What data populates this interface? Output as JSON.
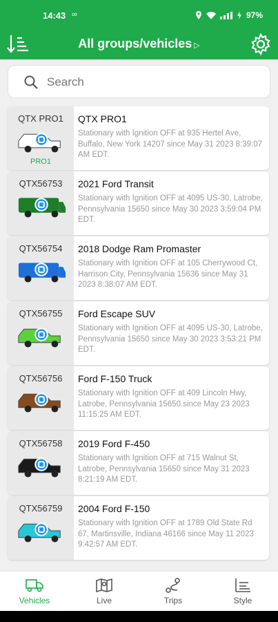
{
  "status": {
    "time": "14:43",
    "left_icon": "∞",
    "battery": "97%"
  },
  "header": {
    "title": "All groups/vehicles",
    "sort_icon": "sort-icon",
    "settings_icon": "gear-icon"
  },
  "search": {
    "placeholder": "Search"
  },
  "colors": {
    "brand": "#1faa4b",
    "vehicle_marker": "#2196f3"
  },
  "vehicles": [
    {
      "code": "QTX PRO1",
      "group": "PRO1",
      "name": "QTX PRO1",
      "desc": "Stationary with Ignition OFF at 935 Hertel Ave, Buffalo, New York 14207 since May 31 2023 8:39:07 AM EDT.",
      "color": "#ffffff"
    },
    {
      "code": "QTX56753",
      "group": "",
      "name": "2021 Ford Transit",
      "desc": "Stationary with Ignition OFF at 4095 US-30, Latrobe, Pennsylvania 15650 since May 30 2023 3:59:04 PM EDT.",
      "color": "#1e7d2a"
    },
    {
      "code": "QTX56754",
      "group": "",
      "name": "2018 Dodge Ram Promaster",
      "desc": "Stationary with Ignition OFF at 105 Cherrywood Ct, Harrison City, Pennsylvania 15636 since May 31 2023 8:38:07 AM EDT.",
      "color": "#1e6fd8"
    },
    {
      "code": "QTX56755",
      "group": "",
      "name": "Ford Escape SUV",
      "desc": "Stationary with Ignition OFF at 4095 US-30, Latrobe, Pennsylvania 15650 since May 30 2023 3:53:21 PM EDT.",
      "color": "#5cd13a"
    },
    {
      "code": "QTX56756",
      "group": "",
      "name": "Ford F-150 Truck",
      "desc": "Stationary with Ignition OFF at 409 Lincoln Hwy, Latrobe, Pennsylvania 15650 since May 23 2023 11:15:25 AM EDT.",
      "color": "#8a4b1c"
    },
    {
      "code": "QTX56758",
      "group": "",
      "name": "2019 Ford F-450",
      "desc": "Stationary with Ignition OFF at 715 Walnut St, Latrobe, Pennsylvania 15650 since May 31 2023 8:21:19 AM EDT.",
      "color": "#1a1a1a"
    },
    {
      "code": "QTX56759",
      "group": "",
      "name": "2004 Ford F-150",
      "desc": "Stationary with Ignition OFF at 1789 Old State Rd 67, Martinsville, Indiana 46166 since May 11 2023 9:42:57 AM EDT.",
      "color": "#27c7d6"
    }
  ],
  "nav": {
    "vehicles": "Vehicles",
    "live": "Live",
    "trips": "Trips",
    "style": "Style"
  }
}
